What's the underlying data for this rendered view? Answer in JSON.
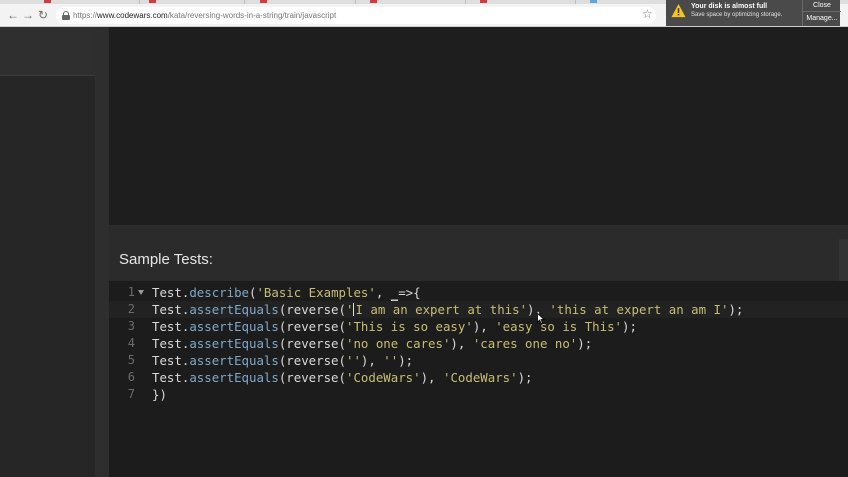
{
  "browser": {
    "url_prefix": "https://",
    "url_host": "www.codewars.com",
    "url_path": "/kata/reversing-words-in-a-string/train/javascript"
  },
  "notification": {
    "title": "Your disk is almost full",
    "subtitle": "Save space by optimizing storage.",
    "close_label": "Close",
    "manage_label": "Manage..."
  },
  "tests": {
    "heading": "Sample Tests:",
    "line_numbers": [
      "1",
      "2",
      "3",
      "4",
      "5",
      "6",
      "7"
    ],
    "lines": [
      [
        {
          "t": "Test.",
          "c": "plain"
        },
        {
          "t": "describe",
          "c": "fn"
        },
        {
          "t": "(",
          "c": "plain"
        },
        {
          "t": "'Basic Examples'",
          "c": "str"
        },
        {
          "t": ", ",
          "c": "plain"
        },
        {
          "t": "_",
          "c": "ul"
        },
        {
          "t": "=>{",
          "c": "plain"
        }
      ],
      [
        {
          "t": "Test.",
          "c": "plain"
        },
        {
          "t": "assertEquals",
          "c": "fn"
        },
        {
          "t": "(reverse(",
          "c": "plain"
        },
        {
          "t": "'",
          "c": "str"
        },
        {
          "t": "",
          "c": "cursor"
        },
        {
          "t": "I am an expert at this'",
          "c": "str"
        },
        {
          "t": "), ",
          "c": "plain"
        },
        {
          "t": "'this at expert an am I'",
          "c": "str"
        },
        {
          "t": ");",
          "c": "plain"
        }
      ],
      [
        {
          "t": "Test.",
          "c": "plain"
        },
        {
          "t": "assertEquals",
          "c": "fn"
        },
        {
          "t": "(reverse(",
          "c": "plain"
        },
        {
          "t": "'This is so easy'",
          "c": "str"
        },
        {
          "t": "), ",
          "c": "plain"
        },
        {
          "t": "'easy so is This'",
          "c": "str"
        },
        {
          "t": ");",
          "c": "plain"
        }
      ],
      [
        {
          "t": "Test.",
          "c": "plain"
        },
        {
          "t": "assertEquals",
          "c": "fn"
        },
        {
          "t": "(reverse(",
          "c": "plain"
        },
        {
          "t": "'no one cares'",
          "c": "str"
        },
        {
          "t": "), ",
          "c": "plain"
        },
        {
          "t": "'cares one no'",
          "c": "str"
        },
        {
          "t": ");",
          "c": "plain"
        }
      ],
      [
        {
          "t": "Test.",
          "c": "plain"
        },
        {
          "t": "assertEquals",
          "c": "fn"
        },
        {
          "t": "(reverse(",
          "c": "plain"
        },
        {
          "t": "''",
          "c": "str"
        },
        {
          "t": "), ",
          "c": "plain"
        },
        {
          "t": "''",
          "c": "str"
        },
        {
          "t": ");",
          "c": "plain"
        }
      ],
      [
        {
          "t": "Test.",
          "c": "plain"
        },
        {
          "t": "assertEquals",
          "c": "fn"
        },
        {
          "t": "(reverse(",
          "c": "plain"
        },
        {
          "t": "'CodeWars'",
          "c": "str"
        },
        {
          "t": "), ",
          "c": "plain"
        },
        {
          "t": "'CodeWars'",
          "c": "str"
        },
        {
          "t": ");",
          "c": "plain"
        }
      ],
      [
        {
          "t": "})",
          "c": "plain"
        }
      ]
    ]
  },
  "colors": {
    "function": "#7fa8c9",
    "string": "#c7bd75",
    "code_text": "#d9d9d9",
    "editor_bg": "#1c1c1c",
    "warning": "#f5c518"
  },
  "icons": {
    "back": "arrow-left-icon",
    "forward": "arrow-right-icon",
    "reload": "reload-icon",
    "lock": "lock-icon",
    "bookmark": "star-icon",
    "warning": "warning-icon",
    "fold": "fold-arrow-icon",
    "pointer": "mouse-pointer-icon"
  }
}
